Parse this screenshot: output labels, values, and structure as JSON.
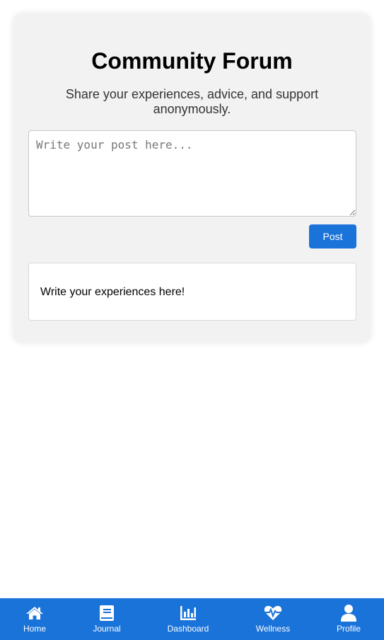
{
  "forum": {
    "title": "Community Forum",
    "subtitle": "Share your experiences, advice, and support anonymously.",
    "input_placeholder": "Write your post here...",
    "post_button": "Post",
    "posts": [
      {
        "text": "Write your experiences here!"
      }
    ]
  },
  "nav": {
    "items": [
      {
        "label": "Home",
        "icon": "home-icon"
      },
      {
        "label": "Journal",
        "icon": "book-icon"
      },
      {
        "label": "Dashboard",
        "icon": "chart-icon"
      },
      {
        "label": "Wellness",
        "icon": "heartbeat-icon"
      },
      {
        "label": "Profile",
        "icon": "user-icon"
      }
    ]
  },
  "colors": {
    "accent": "#1a73d9",
    "card_background": "#f2f2f2"
  }
}
